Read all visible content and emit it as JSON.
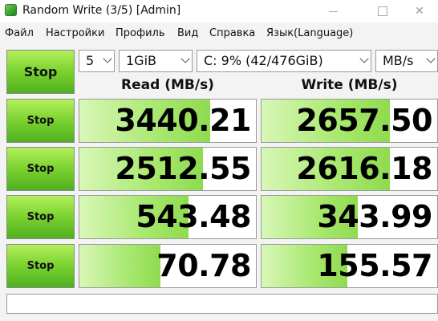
{
  "window": {
    "title": "Random Write (3/5) [Admin]",
    "minimize_label": "—",
    "close_label": "✕"
  },
  "menu": {
    "items": [
      "Файл",
      "Настройки",
      "Профиль",
      "Вид",
      "Справка",
      "Язык(Language)"
    ]
  },
  "controls": {
    "all_button_label": "Stop",
    "test_count": "5",
    "test_size": "1GiB",
    "drive": "C: 9% (42/476GiB)",
    "unit": "MB/s"
  },
  "headers": {
    "read": "Read (MB/s)",
    "write": "Write (MB/s)"
  },
  "rows": [
    {
      "button": "Stop",
      "read": "3440.21",
      "write": "2657.50",
      "read_level": 0.74,
      "write_level": 0.73
    },
    {
      "button": "Stop",
      "read": "2512.55",
      "write": "2616.18",
      "read_level": 0.7,
      "write_level": 0.73
    },
    {
      "button": "Stop",
      "read": "543.48",
      "write": "343.99",
      "read_level": 0.62,
      "write_level": 0.55
    },
    {
      "button": "Stop",
      "read": "70.78",
      "write": "155.57",
      "read_level": 0.46,
      "write_level": 0.49
    }
  ],
  "comment": "",
  "colors": {
    "button_green": "#7fd531",
    "bar_green": "#a8e86f"
  }
}
